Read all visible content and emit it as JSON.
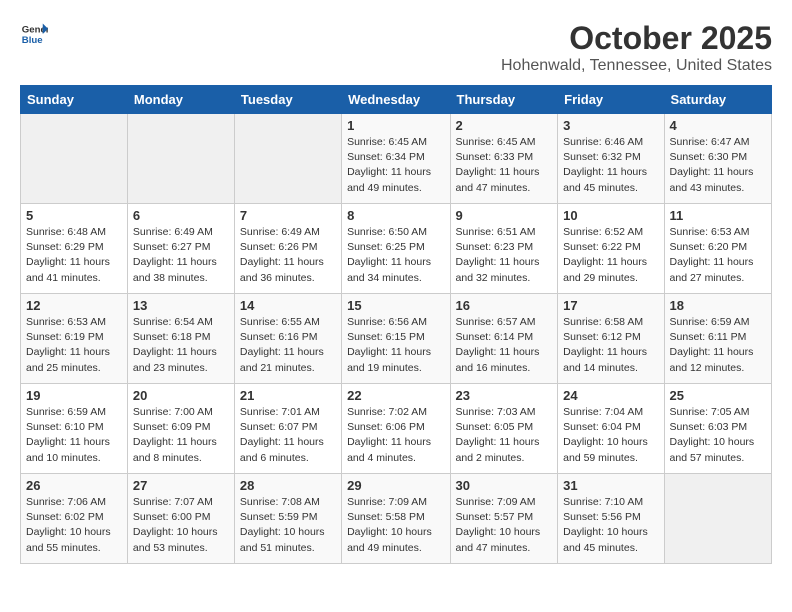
{
  "header": {
    "logo_general": "General",
    "logo_blue": "Blue",
    "month": "October 2025",
    "location": "Hohenwald, Tennessee, United States"
  },
  "weekdays": [
    "Sunday",
    "Monday",
    "Tuesday",
    "Wednesday",
    "Thursday",
    "Friday",
    "Saturday"
  ],
  "weeks": [
    [
      {
        "day": "",
        "info": ""
      },
      {
        "day": "",
        "info": ""
      },
      {
        "day": "",
        "info": ""
      },
      {
        "day": "1",
        "info": "Sunrise: 6:45 AM\nSunset: 6:34 PM\nDaylight: 11 hours\nand 49 minutes."
      },
      {
        "day": "2",
        "info": "Sunrise: 6:45 AM\nSunset: 6:33 PM\nDaylight: 11 hours\nand 47 minutes."
      },
      {
        "day": "3",
        "info": "Sunrise: 6:46 AM\nSunset: 6:32 PM\nDaylight: 11 hours\nand 45 minutes."
      },
      {
        "day": "4",
        "info": "Sunrise: 6:47 AM\nSunset: 6:30 PM\nDaylight: 11 hours\nand 43 minutes."
      }
    ],
    [
      {
        "day": "5",
        "info": "Sunrise: 6:48 AM\nSunset: 6:29 PM\nDaylight: 11 hours\nand 41 minutes."
      },
      {
        "day": "6",
        "info": "Sunrise: 6:49 AM\nSunset: 6:27 PM\nDaylight: 11 hours\nand 38 minutes."
      },
      {
        "day": "7",
        "info": "Sunrise: 6:49 AM\nSunset: 6:26 PM\nDaylight: 11 hours\nand 36 minutes."
      },
      {
        "day": "8",
        "info": "Sunrise: 6:50 AM\nSunset: 6:25 PM\nDaylight: 11 hours\nand 34 minutes."
      },
      {
        "day": "9",
        "info": "Sunrise: 6:51 AM\nSunset: 6:23 PM\nDaylight: 11 hours\nand 32 minutes."
      },
      {
        "day": "10",
        "info": "Sunrise: 6:52 AM\nSunset: 6:22 PM\nDaylight: 11 hours\nand 29 minutes."
      },
      {
        "day": "11",
        "info": "Sunrise: 6:53 AM\nSunset: 6:20 PM\nDaylight: 11 hours\nand 27 minutes."
      }
    ],
    [
      {
        "day": "12",
        "info": "Sunrise: 6:53 AM\nSunset: 6:19 PM\nDaylight: 11 hours\nand 25 minutes."
      },
      {
        "day": "13",
        "info": "Sunrise: 6:54 AM\nSunset: 6:18 PM\nDaylight: 11 hours\nand 23 minutes."
      },
      {
        "day": "14",
        "info": "Sunrise: 6:55 AM\nSunset: 6:16 PM\nDaylight: 11 hours\nand 21 minutes."
      },
      {
        "day": "15",
        "info": "Sunrise: 6:56 AM\nSunset: 6:15 PM\nDaylight: 11 hours\nand 19 minutes."
      },
      {
        "day": "16",
        "info": "Sunrise: 6:57 AM\nSunset: 6:14 PM\nDaylight: 11 hours\nand 16 minutes."
      },
      {
        "day": "17",
        "info": "Sunrise: 6:58 AM\nSunset: 6:12 PM\nDaylight: 11 hours\nand 14 minutes."
      },
      {
        "day": "18",
        "info": "Sunrise: 6:59 AM\nSunset: 6:11 PM\nDaylight: 11 hours\nand 12 minutes."
      }
    ],
    [
      {
        "day": "19",
        "info": "Sunrise: 6:59 AM\nSunset: 6:10 PM\nDaylight: 11 hours\nand 10 minutes."
      },
      {
        "day": "20",
        "info": "Sunrise: 7:00 AM\nSunset: 6:09 PM\nDaylight: 11 hours\nand 8 minutes."
      },
      {
        "day": "21",
        "info": "Sunrise: 7:01 AM\nSunset: 6:07 PM\nDaylight: 11 hours\nand 6 minutes."
      },
      {
        "day": "22",
        "info": "Sunrise: 7:02 AM\nSunset: 6:06 PM\nDaylight: 11 hours\nand 4 minutes."
      },
      {
        "day": "23",
        "info": "Sunrise: 7:03 AM\nSunset: 6:05 PM\nDaylight: 11 hours\nand 2 minutes."
      },
      {
        "day": "24",
        "info": "Sunrise: 7:04 AM\nSunset: 6:04 PM\nDaylight: 10 hours\nand 59 minutes."
      },
      {
        "day": "25",
        "info": "Sunrise: 7:05 AM\nSunset: 6:03 PM\nDaylight: 10 hours\nand 57 minutes."
      }
    ],
    [
      {
        "day": "26",
        "info": "Sunrise: 7:06 AM\nSunset: 6:02 PM\nDaylight: 10 hours\nand 55 minutes."
      },
      {
        "day": "27",
        "info": "Sunrise: 7:07 AM\nSunset: 6:00 PM\nDaylight: 10 hours\nand 53 minutes."
      },
      {
        "day": "28",
        "info": "Sunrise: 7:08 AM\nSunset: 5:59 PM\nDaylight: 10 hours\nand 51 minutes."
      },
      {
        "day": "29",
        "info": "Sunrise: 7:09 AM\nSunset: 5:58 PM\nDaylight: 10 hours\nand 49 minutes."
      },
      {
        "day": "30",
        "info": "Sunrise: 7:09 AM\nSunset: 5:57 PM\nDaylight: 10 hours\nand 47 minutes."
      },
      {
        "day": "31",
        "info": "Sunrise: 7:10 AM\nSunset: 5:56 PM\nDaylight: 10 hours\nand 45 minutes."
      },
      {
        "day": "",
        "info": ""
      }
    ]
  ]
}
